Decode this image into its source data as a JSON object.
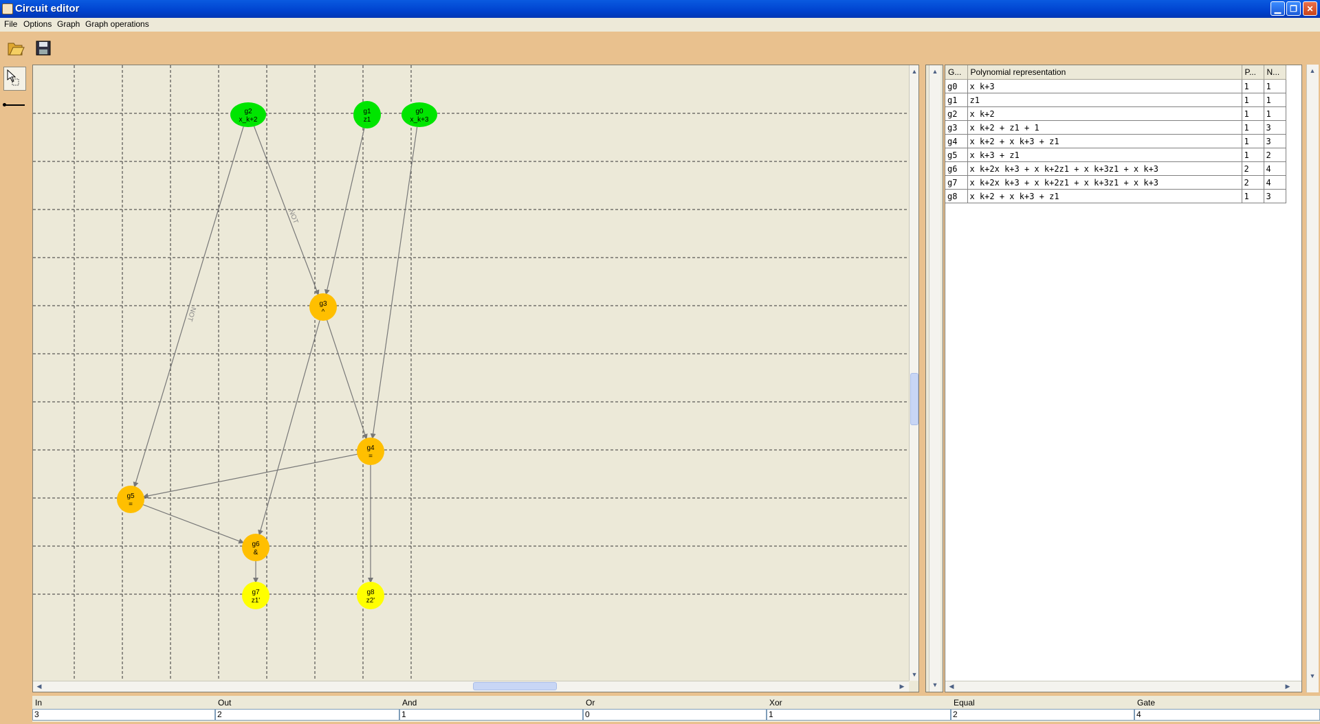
{
  "window": {
    "title": "Circuit editor"
  },
  "menu": [
    {
      "key": "file",
      "label": "File"
    },
    {
      "key": "options",
      "label": "Options"
    },
    {
      "key": "graph",
      "label": "Graph"
    },
    {
      "key": "graph_operations",
      "label": "Graph operations"
    }
  ],
  "toolbar": {
    "open_icon": "folder-open-icon",
    "save_icon": "floppy-save-icon"
  },
  "palette": {
    "select_icon": "pointer-select-icon",
    "edge_icon": "edge-line-icon"
  },
  "graph": {
    "nodes": [
      {
        "id": "g2",
        "sub": "x_k+2",
        "kind": "input",
        "color": "#00e500"
      },
      {
        "id": "g1",
        "sub": "z1",
        "kind": "input",
        "color": "#00e500"
      },
      {
        "id": "g0",
        "sub": "x_k+3",
        "kind": "input",
        "color": "#00e500"
      },
      {
        "id": "g3",
        "sub": "^",
        "kind": "gate",
        "color": "#ffbf00"
      },
      {
        "id": "g4",
        "sub": "=",
        "kind": "gate",
        "color": "#ffbf00"
      },
      {
        "id": "g5",
        "sub": "=",
        "kind": "gate",
        "color": "#ffbf00"
      },
      {
        "id": "g6",
        "sub": "&",
        "kind": "gate",
        "color": "#ffbf00"
      },
      {
        "id": "g7",
        "sub": "z1'",
        "kind": "output",
        "color": "#ffff00"
      },
      {
        "id": "g8",
        "sub": "z2'",
        "kind": "output",
        "color": "#ffff00"
      }
    ],
    "edges": [
      {
        "from": "g2",
        "to": "g3",
        "label": "NOT"
      },
      {
        "from": "g2",
        "to": "g5",
        "label": "NOT"
      },
      {
        "from": "g1",
        "to": "g3",
        "label": ""
      },
      {
        "from": "g0",
        "to": "g4",
        "label": ""
      },
      {
        "from": "g3",
        "to": "g4",
        "label": ""
      },
      {
        "from": "g3",
        "to": "g6",
        "label": ""
      },
      {
        "from": "g4",
        "to": "g5",
        "label": ""
      },
      {
        "from": "g4",
        "to": "g8",
        "label": ""
      },
      {
        "from": "g5",
        "to": "g6",
        "label": ""
      },
      {
        "from": "g6",
        "to": "g7",
        "label": ""
      }
    ]
  },
  "table": {
    "headers": [
      "G...",
      "Polynomial representation",
      "P...",
      "N..."
    ],
    "rows": [
      [
        "g0",
        "x k+3",
        "1",
        "1"
      ],
      [
        "g1",
        "z1",
        "1",
        "1"
      ],
      [
        "g2",
        "x k+2",
        "1",
        "1"
      ],
      [
        "g3",
        "x k+2 + z1 + 1",
        "1",
        "3"
      ],
      [
        "g4",
        "x k+2 + x k+3 + z1",
        "1",
        "3"
      ],
      [
        "g5",
        "x k+3 + z1",
        "1",
        "2"
      ],
      [
        "g6",
        "x k+2x k+3 + x k+2z1 + x k+3z1 + x k+3",
        "2",
        "4"
      ],
      [
        "g7",
        "x k+2x k+3 + x k+2z1 + x k+3z1 + x k+3",
        "2",
        "4"
      ],
      [
        "g8",
        "x k+2 + x k+3 + z1",
        "1",
        "3"
      ]
    ]
  },
  "stats": [
    {
      "label": "In",
      "value": "3"
    },
    {
      "label": "Out",
      "value": "2"
    },
    {
      "label": "And",
      "value": "1"
    },
    {
      "label": "Or",
      "value": "0"
    },
    {
      "label": "Xor",
      "value": "1"
    },
    {
      "label": "Equal",
      "value": "2"
    },
    {
      "label": "Gate",
      "value": "4"
    }
  ]
}
